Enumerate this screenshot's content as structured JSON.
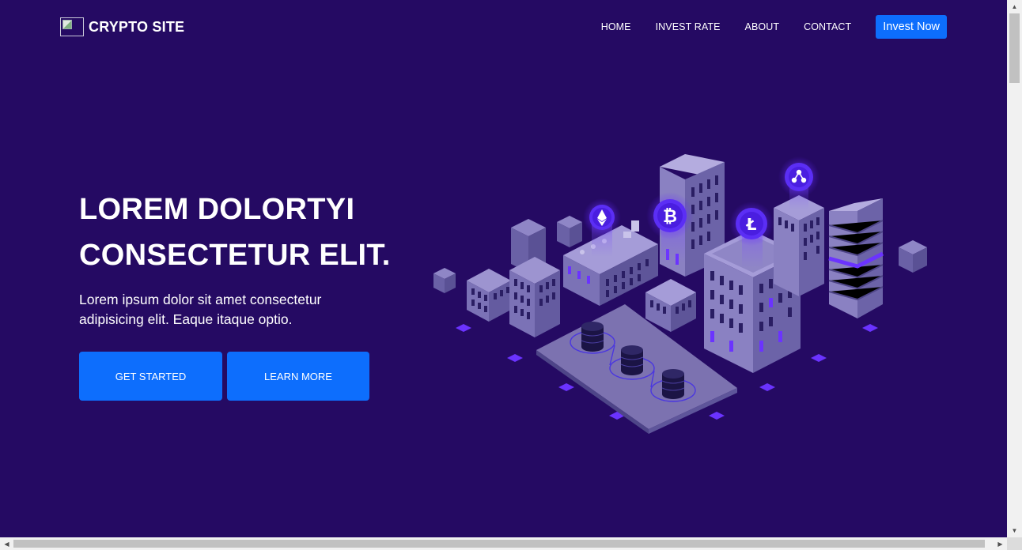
{
  "navbar": {
    "brand": "CRYPTO SITE",
    "logo_icon": "broken-image-icon",
    "links": [
      "HOME",
      "INVEST RATE",
      "ABOUT",
      "CONTACT"
    ],
    "cta": "Invest Now"
  },
  "hero": {
    "title_line1": "LOREM DOLORTYI",
    "title_line2": "CONSECTETUR ELIT.",
    "text": "Lorem ipsum dolor sit amet consectetur adipisicing elit. Eaque itaque optio.",
    "primary_button": "GET STARTED",
    "secondary_button": "LEARN MORE",
    "illustration": {
      "coins": [
        "ethereum-icon",
        "bitcoin-icon",
        "litecoin-icon",
        "ripple-icon"
      ]
    }
  },
  "colors": {
    "background": "#250a63",
    "accent": "#0d6efd",
    "building": "#8a7fc4",
    "glow": "#6b33ff"
  },
  "scrollbars": {
    "vertical": "vertical-scrollbar",
    "horizontal": "horizontal-scrollbar"
  }
}
